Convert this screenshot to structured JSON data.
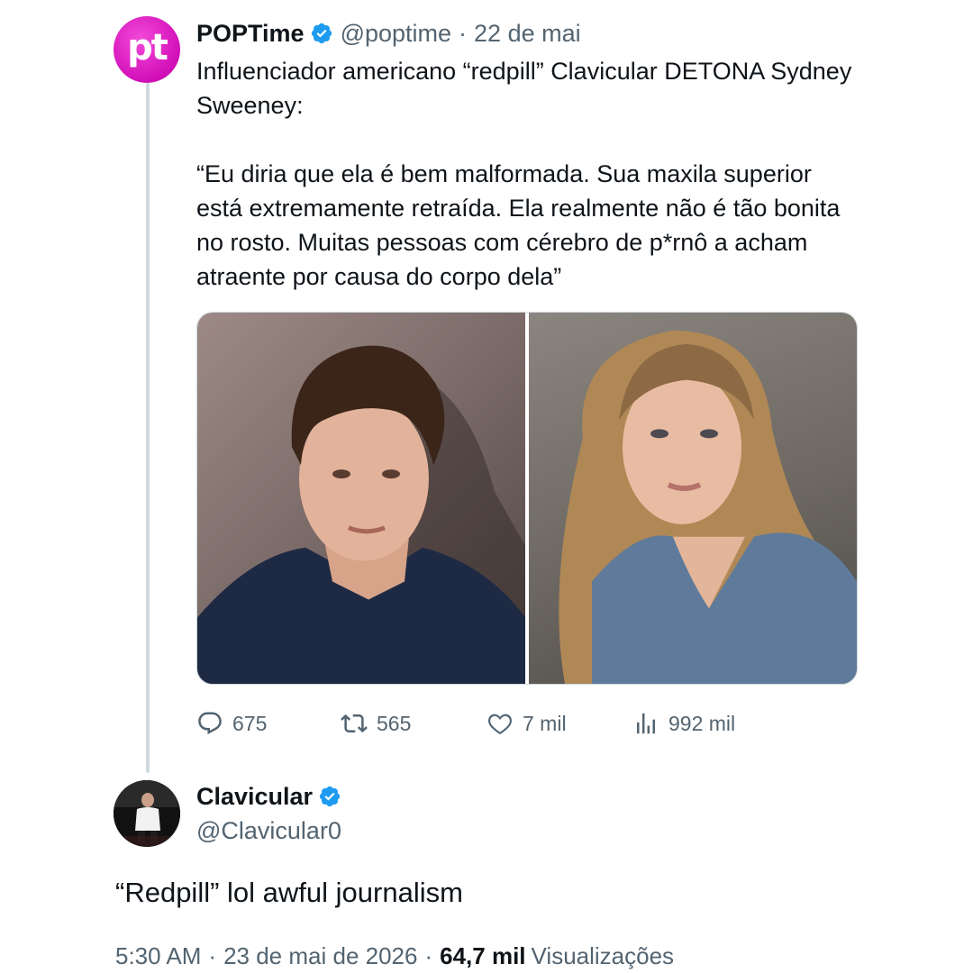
{
  "tweet": {
    "avatar_text": "pt",
    "author_name": "POPTime",
    "author_handle": "@poptime",
    "separator": "·",
    "date": "22 de mai",
    "text_paragraph_1": "Influenciador americano “redpill” Clavicular DETONA Sydney Sweeney:",
    "text_paragraph_2": "“Eu diria que ela é bem malformada. Sua maxila superior está extremamente retraída. Ela realmente não é tão bonita no rosto. Muitas pessoas com cérebro de p*rnô a acham atraente por causa do corpo dela”",
    "stats": {
      "replies": "675",
      "retweets": "565",
      "likes": "7 mil",
      "views": "992 mil"
    }
  },
  "reply": {
    "author_name": "Clavicular",
    "author_handle": "@Clavicular0",
    "text": "“Redpill” lol awful journalism",
    "time": "5:30 AM",
    "separator": "·",
    "date": "23 de mai de 2026",
    "views_count": "64,7 mil",
    "views_label": "Visualizações"
  },
  "colors": {
    "brand_pink": "#d20fb8",
    "verified_blue": "#1d9bf0",
    "muted_text": "#536471",
    "thread_line": "#cfd9de"
  },
  "icons": [
    "verified-badge-icon",
    "reply-icon",
    "retweet-icon",
    "like-icon",
    "views-icon"
  ]
}
